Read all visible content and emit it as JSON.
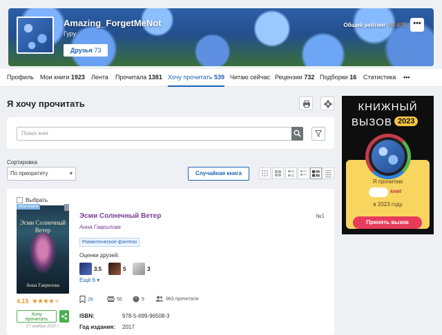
{
  "profile": {
    "username": "Amazing_ForgetMeNot",
    "rank": "Гуру",
    "friends_label": "Друзья",
    "friends_count": "73",
    "rating_label": "Общий рейтинг:",
    "rating_value": "42 476",
    "more": "•••"
  },
  "nav": [
    {
      "label": "Профиль",
      "count": ""
    },
    {
      "label": "Мои книги",
      "count": "1923"
    },
    {
      "label": "Лента",
      "count": ""
    },
    {
      "label": "Прочитала",
      "count": "1381"
    },
    {
      "label": "Хочу прочитать",
      "count": "539"
    },
    {
      "label": "Читаю сейчас",
      "count": ""
    },
    {
      "label": "Рецензии",
      "count": "732"
    },
    {
      "label": "Подборки",
      "count": "16"
    },
    {
      "label": "Статистика",
      "count": ""
    }
  ],
  "nav_more": "•••",
  "page": {
    "title": "Я хочу прочитать",
    "search_placeholder": "Поиск книг",
    "sort_label": "Сортировка",
    "sort_value": "По приоритету",
    "random_button": "Случайная книга"
  },
  "book": {
    "select_label": "Выбрать",
    "badge": "Мои книги",
    "cover_title": "Эсми Солнечный Ветер",
    "cover_author": "Анна Гаврилова",
    "title": "Эсми Солнечный Ветер",
    "author": "Анна Гаврилова",
    "number": "№1",
    "genre": "Романтическое фэнтези",
    "friends_label": "Оценки друзей:",
    "friend_scores": [
      "3.5",
      "5",
      "3"
    ],
    "more_friends": "Ещё 6 ▾",
    "rating": "4.15",
    "stars": "★★★★",
    "star_half": "★",
    "want_button_line1": "Хочу",
    "want_button_line2": "прочитать",
    "added_date": "27 ноября 2020 г.",
    "stats": {
      "wants": "26",
      "reads": "56",
      "quotes": "9",
      "readers": "963 прочитали"
    },
    "isbn_label": "ISBN:",
    "isbn_value": "978-5-699-96508-3",
    "year_label": "Год издания:",
    "year_value": "2017"
  },
  "ad": {
    "line1": "КНИЖНЫЙ",
    "line2": "ВЫЗОВ",
    "year": "2023",
    "text1": "Я прочитаю",
    "books_word": "книг",
    "text2": "в 2023 году",
    "button": "Принять вызов"
  },
  "colors": {
    "accent": "#1d62b5",
    "book_title": "#7a3b9a",
    "star": "#e29a30",
    "green": "#4caf50",
    "ad_button": "#e63b5a"
  }
}
